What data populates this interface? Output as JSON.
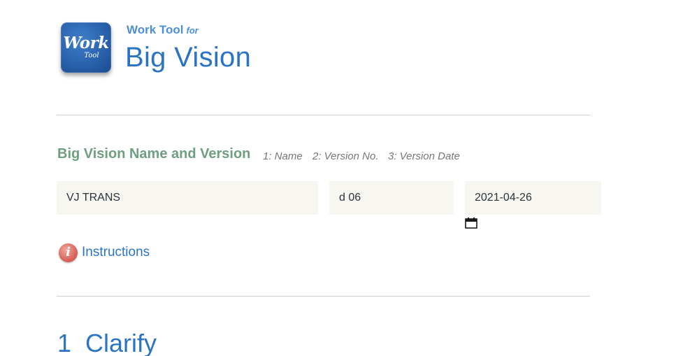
{
  "header": {
    "logo_word": "Work",
    "logo_sub": "Tool",
    "subtitle": "Work Tool",
    "subtitle_for": "for",
    "title": "Big Vision"
  },
  "section": {
    "heading": "Big Vision Name and Version",
    "hints": [
      "1: Name",
      "2: Version No.",
      "3: Version Date"
    ]
  },
  "fields": {
    "name_value": "VJ TRANS",
    "version_value": "d 06",
    "date_value": "2021-04-26"
  },
  "instructions": {
    "icon_glyph": "i",
    "label": "Instructions"
  },
  "step": {
    "number": "1",
    "title": "Clarify"
  },
  "colors": {
    "accent_blue": "#2a74c3",
    "heading_green": "#6e9f80",
    "field_background": "#f8f6f0",
    "info_red": "#dc6a60"
  },
  "icons": {
    "logo": "work-tool-logo-icon",
    "calendar": "calendar-icon",
    "info": "info-icon"
  }
}
